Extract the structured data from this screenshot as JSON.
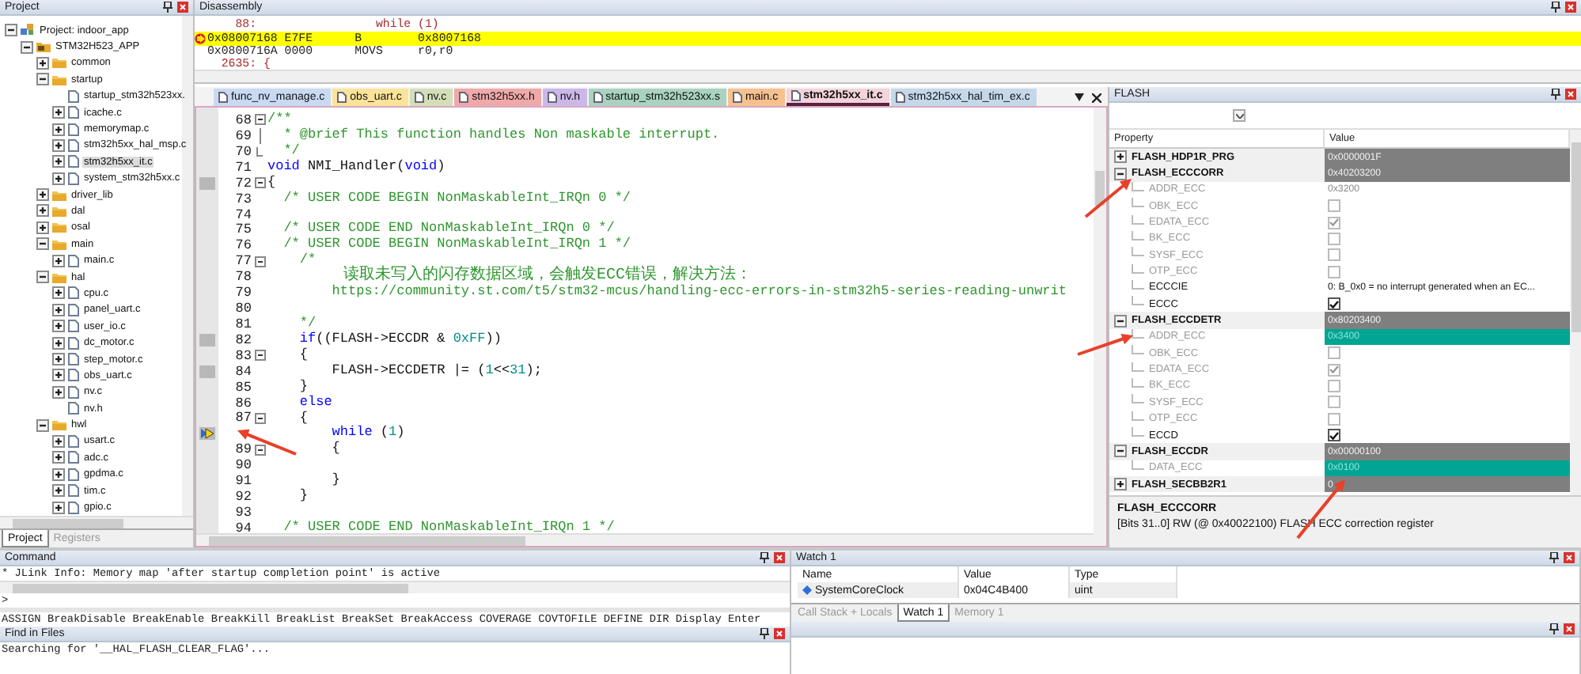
{
  "project": {
    "title": "Project",
    "tree": [
      {
        "label": "Project: indoor_app",
        "kind": "project",
        "expandable": true,
        "expanded": true,
        "selected": false,
        "children": [
          {
            "label": "STM32H523_APP",
            "kind": "target",
            "expandable": true,
            "expanded": true,
            "selected": false,
            "children": [
              {
                "label": "common",
                "kind": "folder",
                "expandable": true,
                "expanded": false,
                "selected": false
              },
              {
                "label": "startup",
                "kind": "folder",
                "expandable": true,
                "expanded": true,
                "selected": false,
                "children": [
                  {
                    "label": "startup_stm32h523xx.",
                    "kind": "file",
                    "expandable": false,
                    "selected": false
                  },
                  {
                    "label": "icache.c",
                    "kind": "file",
                    "expandable": true,
                    "expanded": false,
                    "selected": false
                  },
                  {
                    "label": "memorymap.c",
                    "kind": "file",
                    "expandable": true,
                    "expanded": false,
                    "selected": false
                  },
                  {
                    "label": "stm32h5xx_hal_msp.c",
                    "kind": "file",
                    "expandable": true,
                    "expanded": false,
                    "selected": false
                  },
                  {
                    "label": "stm32h5xx_it.c",
                    "kind": "file",
                    "expandable": true,
                    "expanded": false,
                    "selected": true
                  },
                  {
                    "label": "system_stm32h5xx.c",
                    "kind": "file",
                    "expandable": true,
                    "expanded": false,
                    "selected": false
                  }
                ]
              },
              {
                "label": "driver_lib",
                "kind": "folder",
                "expandable": true,
                "expanded": false,
                "selected": false
              },
              {
                "label": "dal",
                "kind": "folder",
                "expandable": true,
                "expanded": false,
                "selected": false
              },
              {
                "label": "osal",
                "kind": "folder",
                "expandable": true,
                "expanded": false,
                "selected": false
              },
              {
                "label": "main",
                "kind": "folder",
                "expandable": true,
                "expanded": true,
                "selected": false,
                "children": [
                  {
                    "label": "main.c",
                    "kind": "file",
                    "expandable": true,
                    "expanded": false,
                    "selected": false
                  }
                ]
              },
              {
                "label": "hal",
                "kind": "folder",
                "expandable": true,
                "expanded": true,
                "selected": false,
                "children": [
                  {
                    "label": "cpu.c",
                    "kind": "file",
                    "expandable": true,
                    "expanded": false,
                    "selected": false
                  },
                  {
                    "label": "panel_uart.c",
                    "kind": "file",
                    "expandable": true,
                    "expanded": false,
                    "selected": false
                  },
                  {
                    "label": "user_io.c",
                    "kind": "file",
                    "expandable": true,
                    "expanded": false,
                    "selected": false
                  },
                  {
                    "label": "dc_motor.c",
                    "kind": "file",
                    "expandable": true,
                    "expanded": false,
                    "selected": false
                  },
                  {
                    "label": "step_motor.c",
                    "kind": "file",
                    "expandable": true,
                    "expanded": false,
                    "selected": false
                  },
                  {
                    "label": "obs_uart.c",
                    "kind": "file",
                    "expandable": true,
                    "expanded": false,
                    "selected": false
                  },
                  {
                    "label": "nv.c",
                    "kind": "file",
                    "expandable": true,
                    "expanded": false,
                    "selected": false
                  },
                  {
                    "label": "nv.h",
                    "kind": "file",
                    "expandable": false,
                    "selected": false
                  }
                ]
              },
              {
                "label": "hwl",
                "kind": "folder",
                "expandable": true,
                "expanded": true,
                "selected": false,
                "children": [
                  {
                    "label": "usart.c",
                    "kind": "file",
                    "expandable": true,
                    "expanded": false,
                    "selected": false
                  },
                  {
                    "label": "adc.c",
                    "kind": "file",
                    "expandable": true,
                    "expanded": false,
                    "selected": false
                  },
                  {
                    "label": "gpdma.c",
                    "kind": "file",
                    "expandable": true,
                    "expanded": false,
                    "selected": false
                  },
                  {
                    "label": "tim.c",
                    "kind": "file",
                    "expandable": true,
                    "expanded": false,
                    "selected": false
                  },
                  {
                    "label": "gpio.c",
                    "kind": "file",
                    "expandable": true,
                    "expanded": false,
                    "selected": false
                  }
                ]
              }
            ]
          }
        ]
      }
    ],
    "tabs": [
      {
        "label": "Project",
        "selected": true
      },
      {
        "label": "Registers",
        "selected": false
      }
    ]
  },
  "disassembly": {
    "title": "Disassembly",
    "lines": [
      {
        "kind": "source",
        "current": false,
        "text": "    88:                 while (1)"
      },
      {
        "kind": "asm",
        "current": true,
        "text": "0x08007168 E7FE      B        0x8007168"
      },
      {
        "kind": "asm",
        "current": false,
        "text": "0x0800716A 0000      MOVS     r0,r0"
      },
      {
        "kind": "source",
        "current": false,
        "text": "  2635: {"
      }
    ]
  },
  "editor": {
    "tabs": [
      {
        "label": "func_nv_manage.c",
        "color": "#c9d9f2",
        "selected": false
      },
      {
        "label": "obs_uart.c",
        "color": "#fbe49a",
        "selected": false
      },
      {
        "label": "nv.c",
        "color": "#d3dfb8",
        "selected": false
      },
      {
        "label": "stm32h5xx.h",
        "color": "#f0a9a9",
        "selected": false
      },
      {
        "label": "nv.h",
        "color": "#cbb8e8",
        "selected": false
      },
      {
        "label": "startup_stm32h523xx.s",
        "color": "#a9d3c0",
        "selected": false
      },
      {
        "label": "main.c",
        "color": "#f7c08f",
        "selected": false
      },
      {
        "label": "stm32h5xx_it.c",
        "color": "#f3d3dc",
        "selected": true
      },
      {
        "label": "stm32h5xx_hal_tim_ex.c",
        "color": "#c4d8ea",
        "selected": false
      }
    ],
    "lines": [
      {
        "num": "68",
        "fold_open": true,
        "in_fold": false,
        "fold_end": false,
        "executable": false,
        "current": false,
        "segments": [
          {
            "kind": "comment",
            "text": "/**"
          }
        ]
      },
      {
        "num": "69",
        "fold_open": false,
        "in_fold": true,
        "fold_end": false,
        "executable": false,
        "current": false,
        "segments": [
          {
            "kind": "comment",
            "text": "  * @brief This function handles Non maskable interrupt."
          }
        ]
      },
      {
        "num": "70",
        "fold_open": false,
        "in_fold": false,
        "fold_end": true,
        "executable": false,
        "current": false,
        "segments": [
          {
            "kind": "comment",
            "text": "  */"
          }
        ]
      },
      {
        "num": "71",
        "fold_open": false,
        "in_fold": false,
        "fold_end": false,
        "executable": false,
        "current": false,
        "segments": [
          {
            "kind": "keyword",
            "text": "void"
          },
          {
            "kind": "plain",
            "text": " NMI_Handler("
          },
          {
            "kind": "keyword",
            "text": "void"
          },
          {
            "kind": "plain",
            "text": ")"
          }
        ]
      },
      {
        "num": "72",
        "fold_open": true,
        "in_fold": false,
        "fold_end": false,
        "executable": true,
        "current": false,
        "segments": [
          {
            "kind": "plain",
            "text": "{"
          }
        ]
      },
      {
        "num": "73",
        "fold_open": false,
        "in_fold": false,
        "fold_end": false,
        "executable": false,
        "current": false,
        "segments": [
          {
            "kind": "comment",
            "text": "  /* USER CODE BEGIN NonMaskableInt_IRQn 0 */"
          }
        ]
      },
      {
        "num": "74",
        "fold_open": false,
        "in_fold": false,
        "fold_end": false,
        "executable": false,
        "current": false
      },
      {
        "num": "75",
        "fold_open": false,
        "in_fold": false,
        "fold_end": false,
        "executable": false,
        "current": false,
        "segments": [
          {
            "kind": "comment",
            "text": "  /* USER CODE END NonMaskableInt_IRQn 0 */"
          }
        ]
      },
      {
        "num": "76",
        "fold_open": false,
        "in_fold": false,
        "fold_end": false,
        "executable": false,
        "current": false,
        "segments": [
          {
            "kind": "comment",
            "text": "  /* USER CODE BEGIN NonMaskableInt_IRQn 1 */"
          }
        ]
      },
      {
        "num": "77",
        "fold_open": true,
        "in_fold": false,
        "fold_end": false,
        "executable": false,
        "current": false,
        "segments": [
          {
            "kind": "comment",
            "text": "    /*"
          }
        ]
      },
      {
        "num": "78",
        "fold_open": false,
        "in_fold": false,
        "fold_end": false,
        "executable": false,
        "current": false,
        "segments": [
          {
            "kind": "comment_wide",
            "text": "        读取未写入的闪存数据区域，会触发ECC错误，解决方法："
          }
        ]
      },
      {
        "num": "79",
        "fold_open": false,
        "in_fold": false,
        "fold_end": false,
        "executable": false,
        "current": false,
        "segments": [
          {
            "kind": "comment",
            "text": "        https://community.st.com/t5/stm32-mcus/handling-ecc-errors-in-stm32h5-series-reading-unwrit"
          }
        ]
      },
      {
        "num": "80",
        "fold_open": false,
        "in_fold": false,
        "fold_end": false,
        "executable": false,
        "current": false
      },
      {
        "num": "81",
        "fold_open": false,
        "in_fold": false,
        "fold_end": false,
        "executable": false,
        "current": false,
        "segments": [
          {
            "kind": "comment",
            "text": "    */"
          }
        ]
      },
      {
        "num": "82",
        "fold_open": false,
        "in_fold": false,
        "fold_end": false,
        "executable": true,
        "current": false,
        "segments": [
          {
            "kind": "keyword",
            "text": "    if"
          },
          {
            "kind": "plain",
            "text": "((FLASH->ECCDR & "
          },
          {
            "kind": "number",
            "text": "0xFF"
          },
          {
            "kind": "plain",
            "text": "))"
          }
        ]
      },
      {
        "num": "83",
        "fold_open": true,
        "in_fold": false,
        "fold_end": false,
        "executable": false,
        "current": false,
        "segments": [
          {
            "kind": "plain",
            "text": "    {"
          }
        ]
      },
      {
        "num": "84",
        "fold_open": false,
        "in_fold": false,
        "fold_end": false,
        "executable": true,
        "current": false,
        "segments": [
          {
            "kind": "plain",
            "text": "        FLASH->ECCDETR |= ("
          },
          {
            "kind": "number",
            "text": "1"
          },
          {
            "kind": "plain",
            "text": "<<"
          },
          {
            "kind": "number",
            "text": "31"
          },
          {
            "kind": "plain",
            "text": ");"
          }
        ]
      },
      {
        "num": "85",
        "fold_open": false,
        "in_fold": false,
        "fold_end": false,
        "executable": false,
        "current": false,
        "segments": [
          {
            "kind": "plain",
            "text": "    }"
          }
        ]
      },
      {
        "num": "86",
        "fold_open": false,
        "in_fold": false,
        "fold_end": false,
        "executable": false,
        "current": false,
        "segments": [
          {
            "kind": "keyword",
            "text": "    else"
          }
        ]
      },
      {
        "num": "87",
        "fold_open": true,
        "in_fold": false,
        "fold_end": false,
        "executable": false,
        "current": false,
        "segments": [
          {
            "kind": "plain",
            "text": "    {"
          }
        ]
      },
      {
        "fold_open": false,
        "in_fold": false,
        "fold_end": false,
        "executable": false,
        "current": true,
        "segments": [
          {
            "kind": "keyword",
            "text": "        while"
          },
          {
            "kind": "plain",
            "text": " ("
          },
          {
            "kind": "number",
            "text": "1"
          },
          {
            "kind": "plain",
            "text": ")"
          }
        ]
      },
      {
        "num": "89",
        "fold_open": true,
        "in_fold": false,
        "fold_end": false,
        "executable": false,
        "current": false,
        "segments": [
          {
            "kind": "plain",
            "text": "        {"
          }
        ]
      },
      {
        "num": "90",
        "fold_open": false,
        "in_fold": false,
        "fold_end": false,
        "executable": false,
        "current": false
      },
      {
        "num": "91",
        "fold_open": false,
        "in_fold": false,
        "fold_end": false,
        "executable": false,
        "current": false,
        "segments": [
          {
            "kind": "plain",
            "text": "        }"
          }
        ]
      },
      {
        "num": "92",
        "fold_open": false,
        "in_fold": false,
        "fold_end": false,
        "executable": false,
        "current": false,
        "segments": [
          {
            "kind": "plain",
            "text": "    }"
          }
        ]
      },
      {
        "num": "93",
        "fold_open": false,
        "in_fold": false,
        "fold_end": false,
        "executable": false,
        "current": false
      },
      {
        "num": "94",
        "fold_open": false,
        "in_fold": false,
        "fold_end": false,
        "executable": false,
        "current": false,
        "segments": [
          {
            "kind": "comment",
            "text": "  /* USER CODE END NonMaskableInt_IRQn 1 */"
          }
        ]
      }
    ]
  },
  "flash": {
    "title": "FLASH",
    "columns": [
      "Property",
      "Value"
    ],
    "rows": [
      {
        "kind": "register",
        "name": "FLASH_HDP1R_PRG",
        "expanded": false,
        "value": "0x0000001F"
      },
      {
        "kind": "register",
        "name": "FLASH_ECCCORR",
        "expanded": true,
        "value": "0x40203200"
      },
      {
        "kind": "text",
        "name": "ADDR_ECC",
        "readonly": true,
        "changed": false,
        "value": "0x3200"
      },
      {
        "kind": "check",
        "name": "OBK_ECC",
        "readonly": true,
        "checked": false
      },
      {
        "kind": "check",
        "name": "EDATA_ECC",
        "readonly": true,
        "checked": true
      },
      {
        "kind": "check",
        "name": "BK_ECC",
        "readonly": true,
        "checked": false
      },
      {
        "kind": "check",
        "name": "SYSF_ECC",
        "readonly": true,
        "checked": false
      },
      {
        "kind": "check",
        "name": "OTP_ECC",
        "readonly": true,
        "checked": false
      },
      {
        "kind": "text",
        "name": "ECCCIE",
        "readonly": false,
        "changed": false,
        "value": "0: B_0x0 = no interrupt generated when an EC..."
      },
      {
        "kind": "check",
        "name": "ECCC",
        "readonly": false,
        "checked": true
      },
      {
        "kind": "register",
        "name": "FLASH_ECCDETR",
        "expanded": true,
        "value": "0x80203400"
      },
      {
        "kind": "text",
        "name": "ADDR_ECC",
        "readonly": true,
        "changed": true,
        "value": "0x3400"
      },
      {
        "kind": "check",
        "name": "OBK_ECC",
        "readonly": true,
        "checked": false
      },
      {
        "kind": "check",
        "name": "EDATA_ECC",
        "readonly": true,
        "checked": true
      },
      {
        "kind": "check",
        "name": "BK_ECC",
        "readonly": true,
        "checked": false
      },
      {
        "kind": "check",
        "name": "SYSF_ECC",
        "readonly": true,
        "checked": false
      },
      {
        "kind": "check",
        "name": "OTP_ECC",
        "readonly": true,
        "checked": false
      },
      {
        "kind": "check",
        "name": "ECCD",
        "readonly": false,
        "checked": true
      },
      {
        "kind": "register",
        "name": "FLASH_ECCDR",
        "expanded": true,
        "value": "0x00000100"
      },
      {
        "kind": "text",
        "name": "DATA_ECC",
        "readonly": true,
        "changed": true,
        "value": "0x0100"
      },
      {
        "kind": "register",
        "name": "FLASH_SECBB2R1",
        "expanded": false,
        "value": "0"
      }
    ],
    "description": {
      "title": "FLASH_ECCCORR",
      "text": "[Bits 31..0] RW (@ 0x40022100) FLASH ECC correction register"
    }
  },
  "command": {
    "title": "Command",
    "output": [
      "* JLink Info: Memory map 'after startup completion point' is active"
    ],
    "prompt": ">",
    "hint": "ASSIGN BreakDisable BreakEnable BreakKill BreakList BreakSet BreakAccess COVERAGE COVTOFILE DEFINE DIR Display Enter"
  },
  "find_in_files": {
    "title": "Find in Files",
    "lines": [
      "Searching for '__HAL_FLASH_CLEAR_FLAG'..."
    ]
  },
  "watch": {
    "title": "Watch 1",
    "columns": [
      "Name",
      "Value",
      "Type"
    ],
    "rows": [
      {
        "name": "SystemCoreClock",
        "value": "0x04C4B400",
        "type": "uint"
      }
    ],
    "tabs": [
      {
        "label": "Call Stack + Locals",
        "selected": false
      },
      {
        "label": "Watch 1",
        "selected": true
      },
      {
        "label": "Memory 1",
        "selected": false
      }
    ]
  }
}
